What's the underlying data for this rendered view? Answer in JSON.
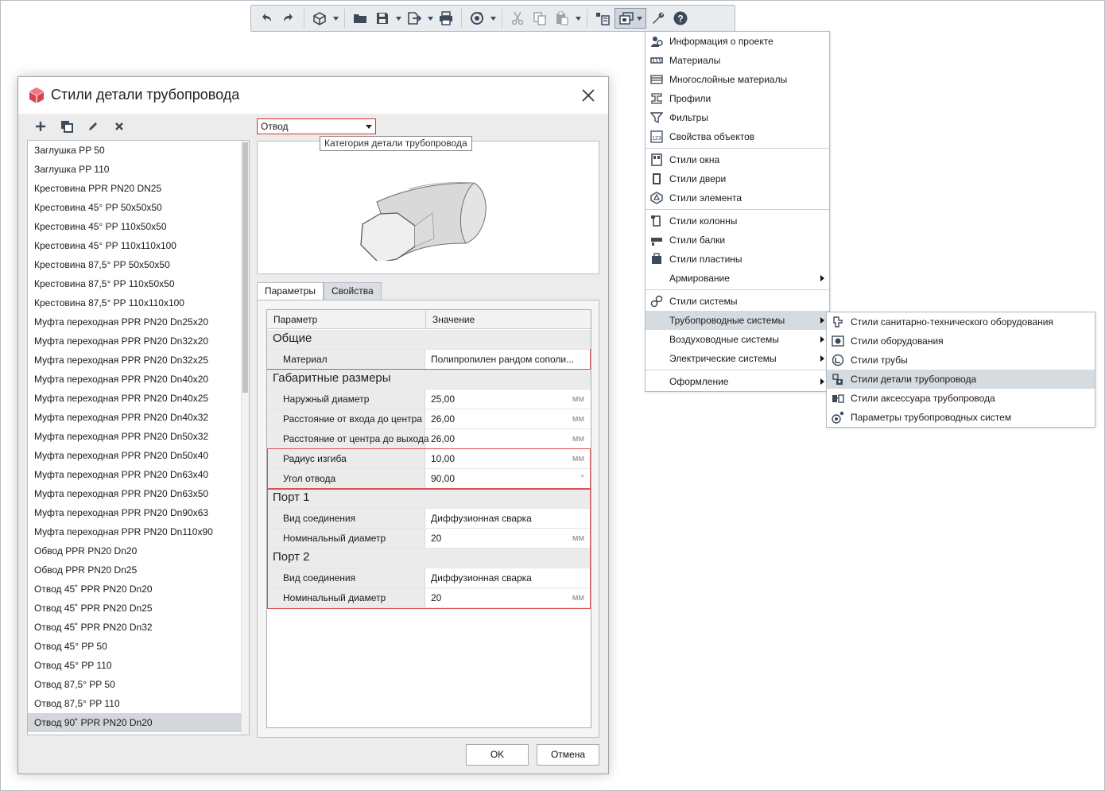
{
  "colors": {
    "accent_icon": "#3d4a5a",
    "selection": "#d3d7dc",
    "highlight_border": "#e05050"
  },
  "toolbar": {
    "icons": [
      "undo-icon",
      "redo-icon",
      "3d-view-icon",
      "open-folder-icon",
      "save-icon",
      "export-icon",
      "print-icon",
      "refresh-icon",
      "cut-icon",
      "copy-icon",
      "paste-icon",
      "properties-icon",
      "styles-icon",
      "settings-wrench-icon",
      "help-icon"
    ]
  },
  "dialog": {
    "title": "Стили детали трубопровода",
    "list_items": [
      "Заглушка PP 50",
      "Заглушка PP 110",
      "Крестовина  PPR PN20 DN25",
      "Крестовина 45° PP 50x50x50",
      "Крестовина 45° PP 110x50x50",
      "Крестовина 45° PP 110x110x100",
      "Крестовина 87,5° PP 50x50x50",
      "Крестовина 87,5° PP 110x50x50",
      "Крестовина 87,5° PP 110x110x100",
      "Муфта переходная PPR PN20 Dn25x20",
      "Муфта переходная PPR PN20 Dn32x20",
      "Муфта переходная PPR PN20 Dn32x25",
      "Муфта переходная PPR PN20 Dn40x20",
      "Муфта переходная PPR PN20 Dn40x25",
      "Муфта переходная PPR PN20 Dn40x32",
      "Муфта переходная PPR PN20 Dn50x32",
      "Муфта переходная PPR PN20 Dn50x40",
      "Муфта переходная PPR PN20 Dn63x40",
      "Муфта переходная PPR PN20 Dn63x50",
      "Муфта переходная PPR PN20 Dn90x63",
      "Муфта переходная PPR PN20 Dn110x90",
      "Обвод PPR PN20 Dn20",
      "Обвод PPR PN20 Dn25",
      "Отвод 45˚ PPR PN20 Dn20",
      "Отвод 45˚ PPR PN20 Dn25",
      "Отвод 45˚ PPR PN20 Dn32",
      "Отвод 45° PP 50",
      "Отвод 45° PP 110",
      "Отвод 87,5° PP 50",
      "Отвод 87,5° PP 110",
      "Отвод 90˚ PPR PN20 Dn20"
    ],
    "selected_item": "Отвод 90˚ PPR PN20 Dn20",
    "category": {
      "value": "Отвод",
      "tooltip": "Категория детали трубопровода"
    },
    "tabs": [
      "Параметры",
      "Свойства"
    ],
    "grid": {
      "col_param": "Параметр",
      "col_value": "Значение",
      "groups": {
        "general": "Общие",
        "dimensions": "Габаритные размеры",
        "port1": "Порт 1",
        "port2": "Порт 2"
      },
      "rows": {
        "material": {
          "name": "Материал",
          "value": "Полипропилен рандом сополи...",
          "unit": ""
        },
        "outer_d": {
          "name": "Наружный диаметр",
          "value": "25,00",
          "unit": "мм"
        },
        "in_center": {
          "name": "Расстояние от входа до центра",
          "value": "26,00",
          "unit": "мм"
        },
        "center_out": {
          "name": "Расстояние от центра до выхода",
          "value": "26,00",
          "unit": "мм"
        },
        "bend_r": {
          "name": "Радиус изгиба",
          "value": "10,00",
          "unit": "мм"
        },
        "angle": {
          "name": "Угол отвода",
          "value": "90,00",
          "unit": "°"
        },
        "p1_conn": {
          "name": "Вид соединения",
          "value": "Диффузионная сварка",
          "unit": ""
        },
        "p1_dn": {
          "name": "Номинальный диаметр",
          "value": "20",
          "unit": "мм"
        },
        "p2_conn": {
          "name": "Вид соединения",
          "value": "Диффузионная сварка",
          "unit": ""
        },
        "p2_dn": {
          "name": "Номинальный диаметр",
          "value": "20",
          "unit": "мм"
        }
      }
    },
    "ok_label": "OK",
    "cancel_label": "Отмена"
  },
  "menu": [
    {
      "label": "Информация о проекте",
      "icon": "project-info-icon"
    },
    {
      "label": "Материалы",
      "icon": "materials-icon"
    },
    {
      "label": "Многослойные материалы",
      "icon": "multilayer-icon"
    },
    {
      "label": "Профили",
      "icon": "profiles-icon"
    },
    {
      "label": "Фильтры",
      "icon": "filter-icon"
    },
    {
      "label": "Свойства объектов",
      "icon": "object-properties-icon"
    },
    {
      "label": "Стили окна",
      "icon": "window-style-icon"
    },
    {
      "label": "Стили двери",
      "icon": "door-style-icon"
    },
    {
      "label": "Стили элемента",
      "icon": "element-style-icon"
    },
    {
      "label": "Стили колонны",
      "icon": "column-style-icon"
    },
    {
      "label": "Стили балки",
      "icon": "beam-style-icon"
    },
    {
      "label": "Стили пластины",
      "icon": "plate-style-icon"
    },
    {
      "label": "Армирование",
      "icon": ""
    },
    {
      "label": "Стили системы",
      "icon": "system-style-icon"
    },
    {
      "label": "Трубопроводные системы",
      "icon": ""
    },
    {
      "label": "Воздуховодные системы",
      "icon": ""
    },
    {
      "label": "Электрические системы",
      "icon": ""
    },
    {
      "label": "Оформление",
      "icon": ""
    }
  ],
  "submenu": [
    {
      "label": "Стили санитарно-технического оборудования",
      "icon": "sanitary-icon"
    },
    {
      "label": "Стили оборудования",
      "icon": "equipment-icon"
    },
    {
      "label": "Стили трубы",
      "icon": "pipe-icon"
    },
    {
      "label": "Стили детали трубопровода",
      "icon": "pipe-fitting-icon"
    },
    {
      "label": "Стили аксессуара трубопровода",
      "icon": "pipe-accessory-icon"
    },
    {
      "label": "Параметры трубопроводных систем",
      "icon": "pipe-system-params-icon"
    }
  ]
}
